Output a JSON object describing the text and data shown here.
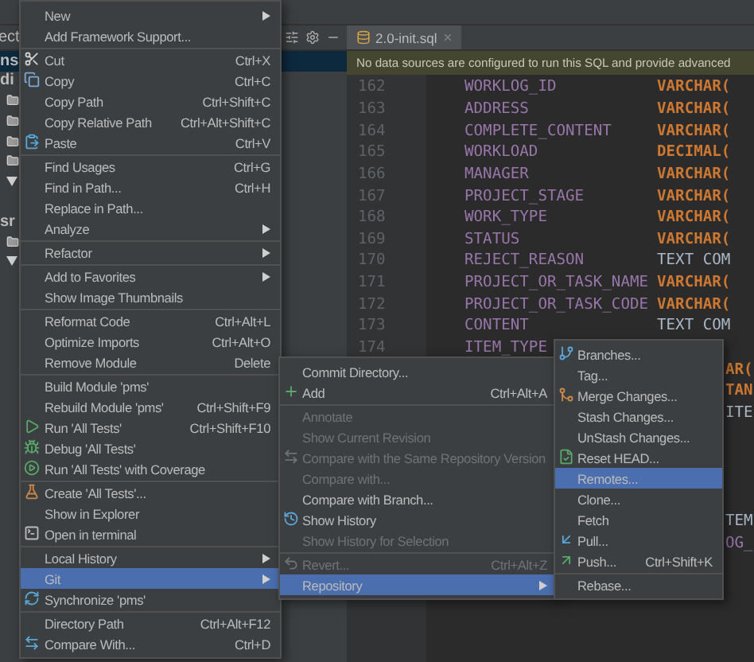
{
  "project_pane": {
    "header": "ect",
    "rows": [
      {
        "kind": "text",
        "text": "ns",
        "selected": true
      },
      {
        "kind": "text",
        "text": "di",
        "selected": false
      },
      {
        "kind": "folder",
        "selected": false
      },
      {
        "kind": "folder",
        "selected": false
      },
      {
        "kind": "folder",
        "selected": false
      },
      {
        "kind": "folder",
        "selected": false
      },
      {
        "kind": "arrow",
        "selected": false
      },
      {
        "kind": "blank",
        "selected": false
      },
      {
        "kind": "text",
        "text": "sr",
        "selected": false
      },
      {
        "kind": "folder",
        "selected": false
      },
      {
        "kind": "arrow",
        "selected": false
      }
    ]
  },
  "editor": {
    "tab": {
      "label": "2.0-init.sql"
    },
    "notice": "No data sources are configured to run this SQL and provide advanced",
    "lines": [
      {
        "number": "162",
        "name": "WORKLOG_ID",
        "type": "VARCHAR(",
        "kind": "keyword"
      },
      {
        "number": "163",
        "name": "ADDRESS",
        "type": "VARCHAR(",
        "kind": "keyword"
      },
      {
        "number": "164",
        "name": "COMPLETE_CONTENT",
        "type": "VARCHAR(",
        "kind": "keyword"
      },
      {
        "number": "165",
        "name": "WORKLOAD",
        "type": "DECIMAL(",
        "kind": "keyword"
      },
      {
        "number": "166",
        "name": "MANAGER",
        "type": "VARCHAR(",
        "kind": "keyword"
      },
      {
        "number": "167",
        "name": "PROJECT_STAGE",
        "type": "VARCHAR(",
        "kind": "keyword"
      },
      {
        "number": "168",
        "name": "WORK_TYPE",
        "type": "VARCHAR(",
        "kind": "keyword"
      },
      {
        "number": "169",
        "name": "STATUS",
        "type": "VARCHAR(",
        "kind": "keyword"
      },
      {
        "number": "170",
        "name": "REJECT_REASON",
        "type": "TEXT COM",
        "kind": "plain"
      },
      {
        "number": "171",
        "name": "PROJECT_OR_TASK_NAME",
        "type": "VARCHAR(",
        "kind": "keyword"
      },
      {
        "number": "172",
        "name": "PROJECT_OR_TASK_CODE",
        "type": "VARCHAR(",
        "kind": "keyword"
      },
      {
        "number": "173",
        "name": "CONTENT",
        "type": "TEXT COM",
        "kind": "plain"
      },
      {
        "number": "174",
        "name": "ITEM_TYPE",
        "kind": "keyword"
      },
      {
        "type": "AR(",
        "kind": "keyword"
      },
      {
        "type": "TAN",
        "kind": "keyword"
      },
      {
        "type": "ITE",
        "kind": "plain"
      },
      {
        "kind": "blank"
      },
      {
        "kind": "blank"
      },
      {
        "kind": "blank"
      },
      {
        "kind": "blank"
      },
      {
        "type": "TEM",
        "kind": "plain"
      },
      {
        "type": "OG_",
        "kind": "name"
      }
    ]
  },
  "main_menu": {
    "items": [
      {
        "kind": "item",
        "label": "New",
        "submenu": true,
        "selected": false,
        "disabled": false
      },
      {
        "kind": "item",
        "label": "Add Framework Support...",
        "submenu": false,
        "selected": false,
        "disabled": false
      },
      {
        "kind": "separator"
      },
      {
        "kind": "item",
        "label": "Cut",
        "shortcut": "Ctrl+X",
        "submenu": false,
        "selected": false,
        "disabled": false
      },
      {
        "kind": "item",
        "label": "Copy",
        "shortcut": "Ctrl+C",
        "submenu": false,
        "selected": false,
        "disabled": false
      },
      {
        "kind": "item",
        "label": "Copy Path",
        "shortcut": "Ctrl+Shift+C",
        "submenu": false,
        "selected": false,
        "disabled": false
      },
      {
        "kind": "item",
        "label": "Copy Relative Path",
        "shortcut": "Ctrl+Alt+Shift+C",
        "submenu": false,
        "selected": false,
        "disabled": false
      },
      {
        "kind": "item",
        "label": "Paste",
        "shortcut": "Ctrl+V",
        "submenu": false,
        "selected": false,
        "disabled": false
      },
      {
        "kind": "separator"
      },
      {
        "kind": "item",
        "label": "Find Usages",
        "shortcut": "Ctrl+G",
        "submenu": false,
        "selected": false,
        "disabled": false
      },
      {
        "kind": "item",
        "label": "Find in Path...",
        "shortcut": "Ctrl+H",
        "submenu": false,
        "selected": false,
        "disabled": false
      },
      {
        "kind": "item",
        "label": "Replace in Path...",
        "submenu": false,
        "selected": false,
        "disabled": false
      },
      {
        "kind": "item",
        "label": "Analyze",
        "submenu": true,
        "selected": false,
        "disabled": false
      },
      {
        "kind": "separator"
      },
      {
        "kind": "item",
        "label": "Refactor",
        "submenu": true,
        "selected": false,
        "disabled": false
      },
      {
        "kind": "separator"
      },
      {
        "kind": "item",
        "label": "Add to Favorites",
        "submenu": true,
        "selected": false,
        "disabled": false
      },
      {
        "kind": "item",
        "label": "Show Image Thumbnails",
        "submenu": false,
        "selected": false,
        "disabled": false
      },
      {
        "kind": "separator"
      },
      {
        "kind": "item",
        "label": "Reformat Code",
        "shortcut": "Ctrl+Alt+L",
        "submenu": false,
        "selected": false,
        "disabled": false
      },
      {
        "kind": "item",
        "label": "Optimize Imports",
        "shortcut": "Ctrl+Alt+O",
        "submenu": false,
        "selected": false,
        "disabled": false
      },
      {
        "kind": "item",
        "label": "Remove Module",
        "shortcut": "Delete",
        "submenu": false,
        "selected": false,
        "disabled": false
      },
      {
        "kind": "separator"
      },
      {
        "kind": "item",
        "label": "Build Module 'pms'",
        "submenu": false,
        "selected": false,
        "disabled": false
      },
      {
        "kind": "item",
        "label": "Rebuild Module 'pms'",
        "shortcut": "Ctrl+Shift+F9",
        "submenu": false,
        "selected": false,
        "disabled": false
      },
      {
        "kind": "item",
        "label": "Run 'All Tests'",
        "shortcut": "Ctrl+Shift+F10",
        "submenu": false,
        "selected": false,
        "disabled": false
      },
      {
        "kind": "item",
        "label": "Debug 'All Tests'",
        "submenu": false,
        "selected": false,
        "disabled": false
      },
      {
        "kind": "item",
        "label": "Run 'All Tests' with Coverage",
        "submenu": false,
        "selected": false,
        "disabled": false
      },
      {
        "kind": "separator"
      },
      {
        "kind": "item",
        "label": "Create 'All Tests'...",
        "submenu": false,
        "selected": false,
        "disabled": false
      },
      {
        "kind": "item",
        "label": "Show in Explorer",
        "submenu": false,
        "selected": false,
        "disabled": false
      },
      {
        "kind": "item",
        "label": "Open in terminal",
        "submenu": false,
        "selected": false,
        "disabled": false
      },
      {
        "kind": "separator"
      },
      {
        "kind": "item",
        "label": "Local History",
        "submenu": true,
        "selected": false,
        "disabled": false
      },
      {
        "kind": "item",
        "label": "Git",
        "submenu": true,
        "selected": true,
        "disabled": false
      },
      {
        "kind": "item",
        "label": "Synchronize 'pms'",
        "submenu": false,
        "selected": false,
        "disabled": false
      },
      {
        "kind": "separator"
      },
      {
        "kind": "item",
        "label": "Directory Path",
        "shortcut": "Ctrl+Alt+F12",
        "submenu": false,
        "selected": false,
        "disabled": false
      },
      {
        "kind": "item",
        "label": "Compare With...",
        "shortcut": "Ctrl+D",
        "submenu": false,
        "selected": false,
        "disabled": false
      }
    ]
  },
  "git_menu": {
    "items": [
      {
        "kind": "item",
        "label": "Commit Directory...",
        "submenu": false,
        "selected": false,
        "disabled": false
      },
      {
        "kind": "item",
        "label": "Add",
        "shortcut": "Ctrl+Alt+A",
        "submenu": false,
        "selected": false,
        "disabled": false
      },
      {
        "kind": "separator"
      },
      {
        "kind": "item",
        "label": "Annotate",
        "submenu": false,
        "selected": false,
        "disabled": true
      },
      {
        "kind": "item",
        "label": "Show Current Revision",
        "submenu": false,
        "selected": false,
        "disabled": true
      },
      {
        "kind": "item",
        "label": "Compare with the Same Repository Version",
        "submenu": false,
        "selected": false,
        "disabled": true
      },
      {
        "kind": "item",
        "label": "Compare with...",
        "submenu": false,
        "selected": false,
        "disabled": true
      },
      {
        "kind": "item",
        "label": "Compare with Branch...",
        "submenu": false,
        "selected": false,
        "disabled": false
      },
      {
        "kind": "item",
        "label": "Show History",
        "submenu": false,
        "selected": false,
        "disabled": false
      },
      {
        "kind": "item",
        "label": "Show History for Selection",
        "submenu": false,
        "selected": false,
        "disabled": true
      },
      {
        "kind": "separator"
      },
      {
        "kind": "item",
        "label": "Revert...",
        "shortcut": "Ctrl+Alt+Z",
        "submenu": false,
        "selected": false,
        "disabled": true
      },
      {
        "kind": "item",
        "label": "Repository",
        "submenu": true,
        "selected": true,
        "disabled": false
      }
    ]
  },
  "repository_menu": {
    "items": [
      {
        "kind": "item",
        "label": "Branches...",
        "submenu": false,
        "selected": false,
        "disabled": false
      },
      {
        "kind": "item",
        "label": "Tag...",
        "submenu": false,
        "selected": false,
        "disabled": false
      },
      {
        "kind": "item",
        "label": "Merge Changes...",
        "submenu": false,
        "selected": false,
        "disabled": false
      },
      {
        "kind": "item",
        "label": "Stash Changes...",
        "submenu": false,
        "selected": false,
        "disabled": false
      },
      {
        "kind": "item",
        "label": "UnStash Changes...",
        "submenu": false,
        "selected": false,
        "disabled": false
      },
      {
        "kind": "item",
        "label": "Reset HEAD...",
        "submenu": false,
        "selected": false,
        "disabled": false
      },
      {
        "kind": "item",
        "label": "Remotes...",
        "submenu": false,
        "selected": true,
        "disabled": false
      },
      {
        "kind": "item",
        "label": "Clone...",
        "submenu": false,
        "selected": false,
        "disabled": false
      },
      {
        "kind": "item",
        "label": "Fetch",
        "submenu": false,
        "selected": false,
        "disabled": false
      },
      {
        "kind": "item",
        "label": "Pull...",
        "submenu": false,
        "selected": false,
        "disabled": false
      },
      {
        "kind": "item",
        "label": "Push...",
        "shortcut": "Ctrl+Shift+K",
        "submenu": false,
        "selected": false,
        "disabled": false
      },
      {
        "kind": "separator"
      },
      {
        "kind": "item",
        "label": "Rebase...",
        "submenu": false,
        "selected": false,
        "disabled": false
      }
    ]
  }
}
